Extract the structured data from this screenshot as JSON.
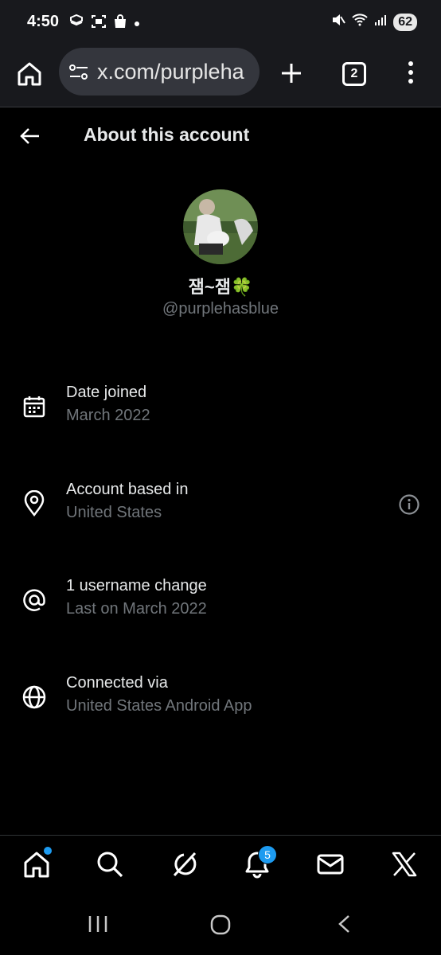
{
  "status_bar": {
    "time": "4:50",
    "battery": "62"
  },
  "browser": {
    "url": "x.com/purpleha",
    "tab_count": "2"
  },
  "header": {
    "title": "About this account"
  },
  "profile": {
    "display_name": "잼~잼🍀",
    "handle": "@purplehasblue"
  },
  "info_rows": [
    {
      "icon": "calendar-icon",
      "label": "Date joined",
      "value": "March 2022"
    },
    {
      "icon": "location-pin-icon",
      "label": "Account based in",
      "value": "United States"
    },
    {
      "icon": "at-sign-icon",
      "label": "1 username change",
      "value": "Last on March 2022"
    },
    {
      "icon": "globe-icon",
      "label": "Connected via",
      "value": "United States Android App"
    }
  ],
  "bottom_nav": {
    "notifications_badge": "5",
    "items": [
      "home-icon",
      "search-icon",
      "grok-icon",
      "notifications-icon",
      "messages-icon",
      "x-logo-icon"
    ]
  },
  "colors": {
    "background": "#000000",
    "primary_text": "#e7e9ea",
    "secondary_text": "#71767b",
    "accent": "#1d9bf0",
    "browser_bar": "#18191d"
  }
}
